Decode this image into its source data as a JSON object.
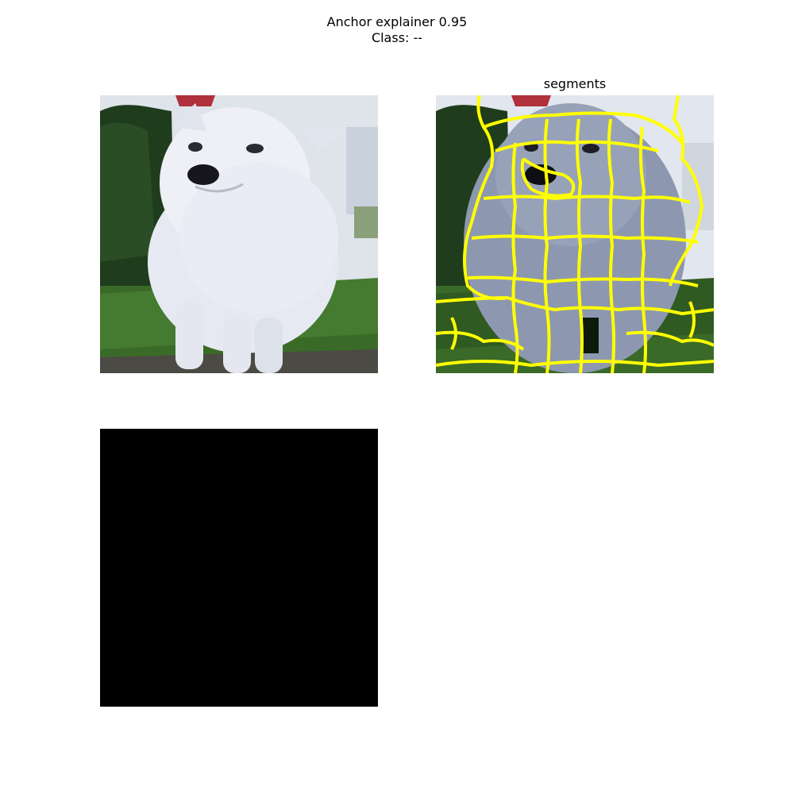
{
  "figure": {
    "title_line1": "Anchor explainer 0.95",
    "title_line2": "Class: --"
  },
  "panels": {
    "original": {
      "subject": "white-fluffy-dog-photo"
    },
    "segments": {
      "title": "segments",
      "boundary_color": "#ffff00"
    },
    "anchor": {
      "fill_color": "#000000"
    }
  },
  "colors": {
    "background": "#ffffff",
    "grass": "#3a6a28",
    "hedge": "#1f3d1c",
    "fur": "#e6e9f2",
    "segment_boundary": "#ffff00"
  }
}
